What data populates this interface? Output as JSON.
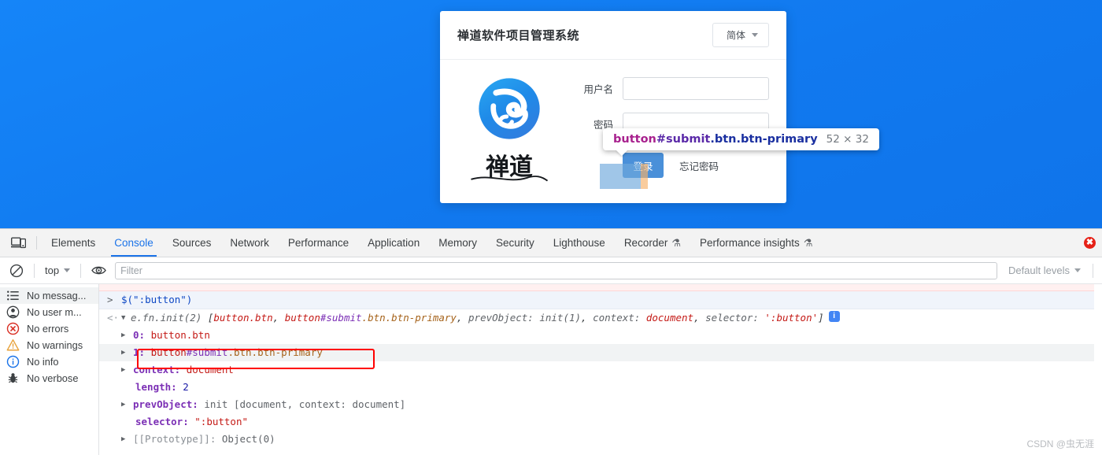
{
  "page": {
    "login_card": {
      "title": "禅道软件项目管理系统",
      "lang_button": "简体",
      "brand_word": "禅道",
      "fields": [
        {
          "label": "用户名",
          "value": "",
          "placeholder": ""
        },
        {
          "label": "密码",
          "value": "",
          "placeholder": ""
        }
      ],
      "submit_label": "登录",
      "forgot_label": "忘记密码"
    },
    "inspect_tooltip": {
      "tag": "button",
      "id": "#submit",
      "classes": ".btn.btn-primary",
      "dimensions": "52 × 32"
    }
  },
  "devtools": {
    "tabs": [
      {
        "label": "Elements",
        "active": false,
        "flask": false
      },
      {
        "label": "Console",
        "active": true,
        "flask": false
      },
      {
        "label": "Sources",
        "active": false,
        "flask": false
      },
      {
        "label": "Network",
        "active": false,
        "flask": false
      },
      {
        "label": "Performance",
        "active": false,
        "flask": false
      },
      {
        "label": "Application",
        "active": false,
        "flask": false
      },
      {
        "label": "Memory",
        "active": false,
        "flask": false
      },
      {
        "label": "Security",
        "active": false,
        "flask": false
      },
      {
        "label": "Lighthouse",
        "active": false,
        "flask": false
      },
      {
        "label": "Recorder",
        "active": false,
        "flask": true
      },
      {
        "label": "Performance insights",
        "active": false,
        "flask": true
      }
    ],
    "error_badge": "",
    "filterbar": {
      "context": "top",
      "filter_placeholder": "Filter",
      "filter_value": "",
      "levels": "Default levels"
    },
    "sidebar": [
      {
        "label": "No messag...",
        "icon": "list-icon",
        "selected": true
      },
      {
        "label": "No user m...",
        "icon": "user-icon",
        "selected": false
      },
      {
        "label": "No errors",
        "icon": "error-icon",
        "selected": false
      },
      {
        "label": "No warnings",
        "icon": "warning-icon",
        "selected": false
      },
      {
        "label": "No info",
        "icon": "info-icon",
        "selected": false
      },
      {
        "label": "No verbose",
        "icon": "bug-icon",
        "selected": false
      }
    ],
    "console": {
      "input_prompt": ">",
      "input_expression": "$(\":button\")",
      "output_prompt": "<·",
      "result_header": {
        "constructor": "e.fn.init(2)",
        "open_bracket": "[",
        "item0": "button.btn",
        "sep1": ", ",
        "item1_tag": "button",
        "item1_id": "#submit",
        "item1_cls": ".btn.btn-primary",
        "sep2": ", ",
        "prevobject_key": "prevObject:",
        "prevobject_val": "init(1)",
        "sep3": ", ",
        "context_key": "context:",
        "context_val": "document",
        "sep4": ", ",
        "selector_key": "selector:",
        "selector_val": "':button'",
        "close_bracket": "]",
        "info_badge": "i"
      },
      "tree": [
        {
          "key": "0:",
          "value": "button.btn",
          "expandable": true,
          "highlighted": false,
          "kind": "element"
        },
        {
          "key": "1:",
          "value": "button#submit.btn.btn-primary",
          "expandable": true,
          "highlighted": true,
          "kind": "element-split",
          "tag": "button",
          "id": "#submit",
          "cls": ".btn.btn-primary"
        },
        {
          "key": "context:",
          "value": "document",
          "expandable": true,
          "highlighted": false,
          "kind": "doc"
        },
        {
          "key": "length:",
          "value": "2",
          "expandable": false,
          "highlighted": false,
          "kind": "number"
        },
        {
          "key": "prevObject:",
          "value": "init [document, context: document]",
          "expandable": true,
          "highlighted": false,
          "kind": "object"
        },
        {
          "key": "selector:",
          "value": "\":button\"",
          "expandable": false,
          "highlighted": false,
          "kind": "string"
        },
        {
          "key": "[[Prototype]]:",
          "value": "Object(0)",
          "expandable": true,
          "highlighted": false,
          "kind": "proto"
        }
      ]
    }
  },
  "watermark": "CSDN @虫无涯",
  "colors": {
    "page_background": "#1180f5",
    "accent_blue": "#1a73e8",
    "annotation_red": "#ff0000",
    "submit_button": "#4a90d9",
    "highlight_content": "#6fa8dc",
    "highlight_padding": "#f6b26b"
  }
}
